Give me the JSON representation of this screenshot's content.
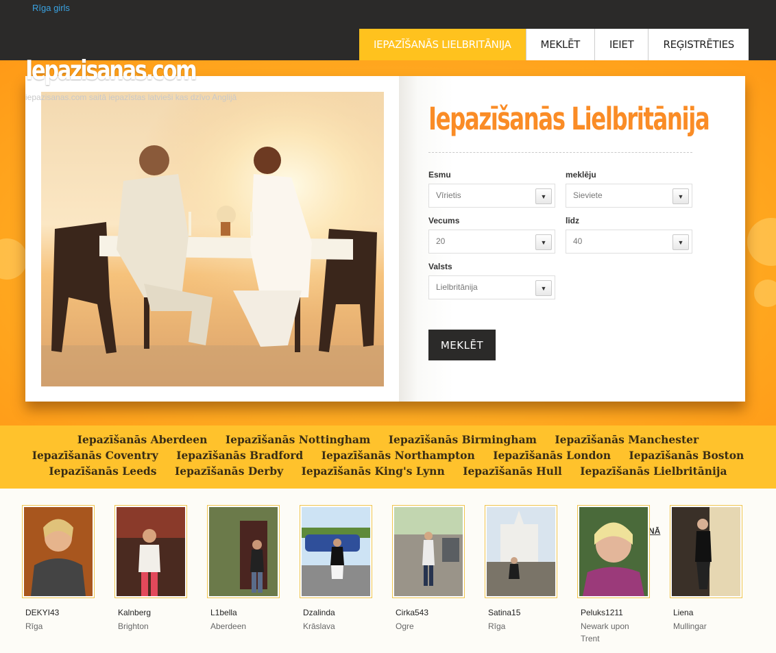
{
  "topbar": {
    "link": "Rīga girls"
  },
  "nav": [
    {
      "label": "IEPAZĪŠANĀS LIELBRITĀNIJA",
      "active": true
    },
    {
      "label": "MEKLĒT"
    },
    {
      "label": "IEIET"
    },
    {
      "label": "REĢISTRĒTIES"
    }
  ],
  "logo": {
    "text": "Iepazisanas.com",
    "tagline": "iepazisanas.com saitā iepazīstas latvieši kas dzīvo Anglijā"
  },
  "search": {
    "title": "Iepazīšanās Lielbritānija",
    "fields": {
      "esmu": {
        "label": "Esmu",
        "value": "Vīrietis"
      },
      "mekleju": {
        "label": "meklēju",
        "value": "Sieviete"
      },
      "vecums": {
        "label": "Vecums",
        "value": "20"
      },
      "lidz": {
        "label": "līdz",
        "value": "40"
      },
      "valsts": {
        "label": "Valsts",
        "value": "Lielbritānija"
      }
    },
    "button": "MEKLĒT",
    "arrow_icon": "chevron-down-icon"
  },
  "city_links": [
    [
      "Iepazīšanās Aberdeen",
      "Iepazīšanās Nottingham",
      "Iepazīšanās Birmingham",
      "Iepazīšanās Manchester"
    ],
    [
      "Iepazīšanās Coventry",
      "Iepazīšanās Bradford",
      "Iepazīšanās Northampton",
      "Iepazīšanās London",
      "Iepazīšanās Boston"
    ],
    [
      "Iepazīšanās Leeds",
      "Iepazīšanās Derby",
      "Iepazīšanās King's Lynn",
      "Iepazīšanās Hull",
      "Iepazīšanās Lielbritānija"
    ]
  ],
  "members": [
    {
      "name": "DEKYI43",
      "city": "Rīga"
    },
    {
      "name": "Kalnberg",
      "city": "Brighton"
    },
    {
      "name": "L1bella",
      "city": "Aberdeen"
    },
    {
      "name": "Dzalinda",
      "city": "Krāslava"
    },
    {
      "name": "Cirka543",
      "city": "Ogre"
    },
    {
      "name": "Satina15",
      "city": "Rīga"
    },
    {
      "name": "Peluks1211",
      "city": "Newark upon Trent"
    },
    {
      "name": "Liena",
      "city": "Mullingar"
    }
  ],
  "members_partial_link": "NĀ",
  "colors": {
    "accent": "#ffc21e",
    "title": "#fa8c26",
    "dark": "#2b2a29",
    "link": "#3aa3e3"
  }
}
